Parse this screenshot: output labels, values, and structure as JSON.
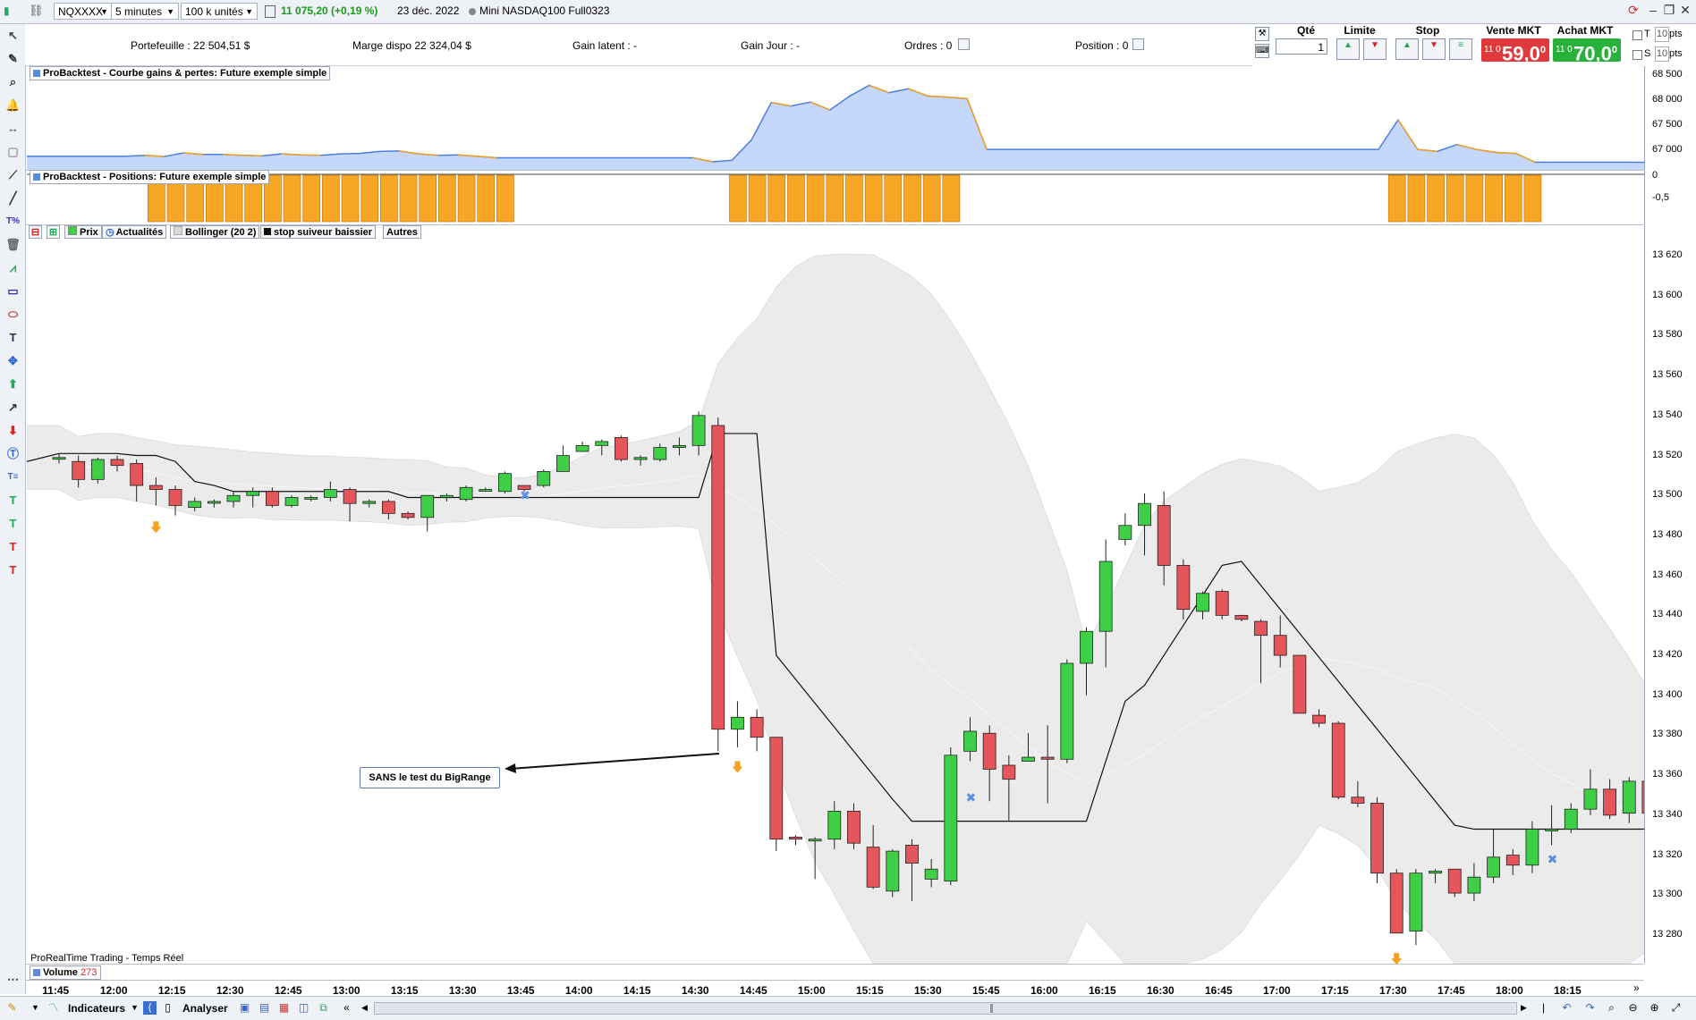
{
  "topbar": {
    "ticker": "NQXXXX",
    "timeframe": "5 minutes",
    "units": "100 k unités",
    "price_change": "11 075,20 (+0,19 %)",
    "date": "23 déc. 2022",
    "instrument": "Mini NASDAQ100 Full0323"
  },
  "infobar": {
    "portefeuille": "Portefeuille :  22 504,51 $",
    "marge": "Marge dispo  22 324,04 $",
    "gain_latent": "Gain latent : -",
    "gain_jour": "Gain Jour : -",
    "ordres": "Ordres : 0",
    "position": "Position : 0"
  },
  "orderpanel": {
    "qte_label": "Qté",
    "qte_value": "1",
    "limite_label": "Limite",
    "stop_label": "Stop",
    "vente_label": "Vente MKT",
    "achat_label": "Achat MKT",
    "vente_prefix": "11 0",
    "vente_price": "59,0",
    "vente_sup": "0",
    "achat_prefix": "11 0",
    "achat_price": "70,0",
    "achat_sup": "0",
    "t_label": "T",
    "s_label": "S",
    "t_value": "10",
    "s_value": "10",
    "pts": "pts"
  },
  "panels": {
    "equity_title": "ProBacktest - Courbe gains & pertes: Future exemple simple",
    "positions_title": "ProBacktest - Positions: Future exemple simple",
    "volume_label": "Volume",
    "volume_value": "273",
    "footer_text": "ProRealTime Trading - Temps Réel",
    "annotation": "SANS le test du BigRange"
  },
  "legend": {
    "prix": "Prix",
    "actualites": "Actualités",
    "bollinger": "Bollinger (20 2)",
    "stop": "stop suiveur baissier",
    "autres": "Autres"
  },
  "equity_axis": [
    "68 500",
    "68 000",
    "67 500",
    "67 000"
  ],
  "positions_axis": [
    "0",
    "-0,5"
  ],
  "price_axis": [
    "13 620",
    "13 600",
    "13 580",
    "13 560",
    "13 540",
    "13 520",
    "13 500",
    "13 480",
    "13 460",
    "13 440",
    "13 420",
    "13 400",
    "13 380",
    "13 360",
    "13 340",
    "13 320",
    "13 300",
    "13 280"
  ],
  "time_axis": [
    "11:45",
    "12:00",
    "12:15",
    "12:30",
    "12:45",
    "13:00",
    "13:15",
    "13:30",
    "13:45",
    "14:00",
    "14:15",
    "14:30",
    "14:45",
    "15:00",
    "15:15",
    "15:30",
    "15:45",
    "16:00",
    "16:15",
    "16:30",
    "16:45",
    "17:00",
    "17:15",
    "17:30",
    "17:45",
    "18:00",
    "18:15"
  ],
  "bottombar": {
    "indicateurs": "Indicateurs",
    "analyser": "Analyser"
  },
  "colors": {
    "up": "#3ecf46",
    "down": "#e4565a",
    "band": "#ebebeb",
    "equity_fill": "#c5d8fb",
    "equity_line_blue": "#4a7fe0",
    "equity_line_orange": "#f5a020",
    "position_bar": "#f7a626",
    "vente": "#e0393d",
    "achat": "#27b03a"
  },
  "chart_data": {
    "type": "candlestick",
    "ylim": [
      13265,
      13630
    ],
    "candles": [
      [
        13519,
        13519,
        13516,
        13521
      ],
      [
        13517,
        13508,
        13504,
        13520
      ],
      [
        13508,
        13518,
        13506,
        13519
      ],
      [
        13518,
        13515,
        13512,
        13520
      ],
      [
        13516,
        13505,
        13497,
        13518
      ],
      [
        13505,
        13503,
        13495,
        13509
      ],
      [
        13503,
        13495,
        13490,
        13505
      ],
      [
        13494,
        13497,
        13492,
        13499
      ],
      [
        13497,
        13497,
        13494,
        13498
      ],
      [
        13497,
        13500,
        13494,
        13502
      ],
      [
        13500,
        13502,
        13494,
        13504
      ],
      [
        13502,
        13495,
        13494,
        13504
      ],
      [
        13495,
        13499,
        13494,
        13500
      ],
      [
        13499,
        13499,
        13497,
        13500
      ],
      [
        13499,
        13503,
        13497,
        13507
      ],
      [
        13503,
        13496,
        13487,
        13504
      ],
      [
        13496,
        13497,
        13494,
        13498
      ],
      [
        13497,
        13491,
        13488,
        13498
      ],
      [
        13491,
        13489,
        13488,
        13492
      ],
      [
        13489,
        13500,
        13482,
        13500
      ],
      [
        13499,
        13500,
        13497,
        13501
      ],
      [
        13498,
        13504,
        13497,
        13505
      ],
      [
        13503,
        13503,
        13502,
        13504
      ],
      [
        13502,
        13511,
        13501,
        13512
      ],
      [
        13505,
        13503,
        13502,
        13504
      ],
      [
        13505,
        13512,
        13504,
        13513
      ],
      [
        13512,
        13520,
        13513,
        13525
      ],
      [
        13522,
        13525,
        13522,
        13527
      ],
      [
        13525,
        13527,
        13520,
        13528
      ],
      [
        13529,
        13518,
        13517,
        13530
      ],
      [
        13518,
        13519,
        13515,
        13520
      ],
      [
        13518,
        13524,
        13517,
        13526
      ],
      [
        13524,
        13525,
        13520,
        13529
      ],
      [
        13525,
        13540,
        13520,
        13542
      ],
      [
        13535,
        13383,
        13372,
        13539
      ],
      [
        13383,
        13389,
        13374,
        13397
      ],
      [
        13389,
        13379,
        13372,
        13393
      ],
      [
        13379,
        13328,
        13322,
        13379
      ],
      [
        13329,
        13328,
        13325,
        13330
      ],
      [
        13328,
        13328,
        13308,
        13329
      ],
      [
        13328,
        13342,
        13323,
        13347
      ],
      [
        13342,
        13326,
        13323,
        13346
      ],
      [
        13324,
        13304,
        13303,
        13335
      ],
      [
        13302,
        13322,
        13299,
        13323
      ],
      [
        13325,
        13316,
        13297,
        13328
      ],
      [
        13308,
        13313,
        13304,
        13318
      ],
      [
        13307,
        13370,
        13305,
        13374
      ],
      [
        13372,
        13382,
        13367,
        13389
      ],
      [
        13381,
        13363,
        13347,
        13385
      ],
      [
        13365,
        13358,
        13337,
        13370
      ],
      [
        13367,
        13369,
        13367,
        13381
      ],
      [
        13369,
        13368,
        13346,
        13385
      ],
      [
        13368,
        13416,
        13366,
        13418
      ],
      [
        13416,
        13432,
        13400,
        13434
      ],
      [
        13432,
        13467,
        13414,
        13478
      ],
      [
        13478,
        13485,
        13475,
        13491
      ],
      [
        13485,
        13496,
        13470,
        13501
      ],
      [
        13495,
        13465,
        13455,
        13502
      ],
      [
        13465,
        13443,
        13438,
        13468
      ],
      [
        13442,
        13451,
        13438,
        13452
      ],
      [
        13452,
        13440,
        13438,
        13453
      ],
      [
        13440,
        13438,
        13437,
        13440
      ],
      [
        13437,
        13430,
        13406,
        13438
      ],
      [
        13430,
        13420,
        13414,
        13440
      ],
      [
        13420,
        13391,
        13391,
        13420
      ],
      [
        13390,
        13386,
        13384,
        13393
      ],
      [
        13386,
        13349,
        13348,
        13387
      ],
      [
        13349,
        13346,
        13344,
        13357
      ],
      [
        13346,
        13311,
        13306,
        13349
      ],
      [
        13311,
        13281,
        13281,
        13313
      ],
      [
        13282,
        13311,
        13275,
        13313
      ],
      [
        13311,
        13312,
        13306,
        13313
      ],
      [
        13313,
        13301,
        13299,
        13313
      ],
      [
        13301,
        13309,
        13297,
        13316
      ],
      [
        13309,
        13319,
        13306,
        13333
      ],
      [
        13320,
        13315,
        13310,
        13323
      ],
      [
        13315,
        13333,
        13311,
        13337
      ],
      [
        13333,
        13333,
        13325,
        13345
      ],
      [
        13333,
        13343,
        13331,
        13346
      ],
      [
        13343,
        13353,
        13340,
        13363
      ],
      [
        13353,
        13340,
        13338,
        13358
      ],
      [
        13341,
        13357,
        13336,
        13359
      ],
      [
        13357,
        13341,
        13332,
        13358
      ]
    ]
  }
}
